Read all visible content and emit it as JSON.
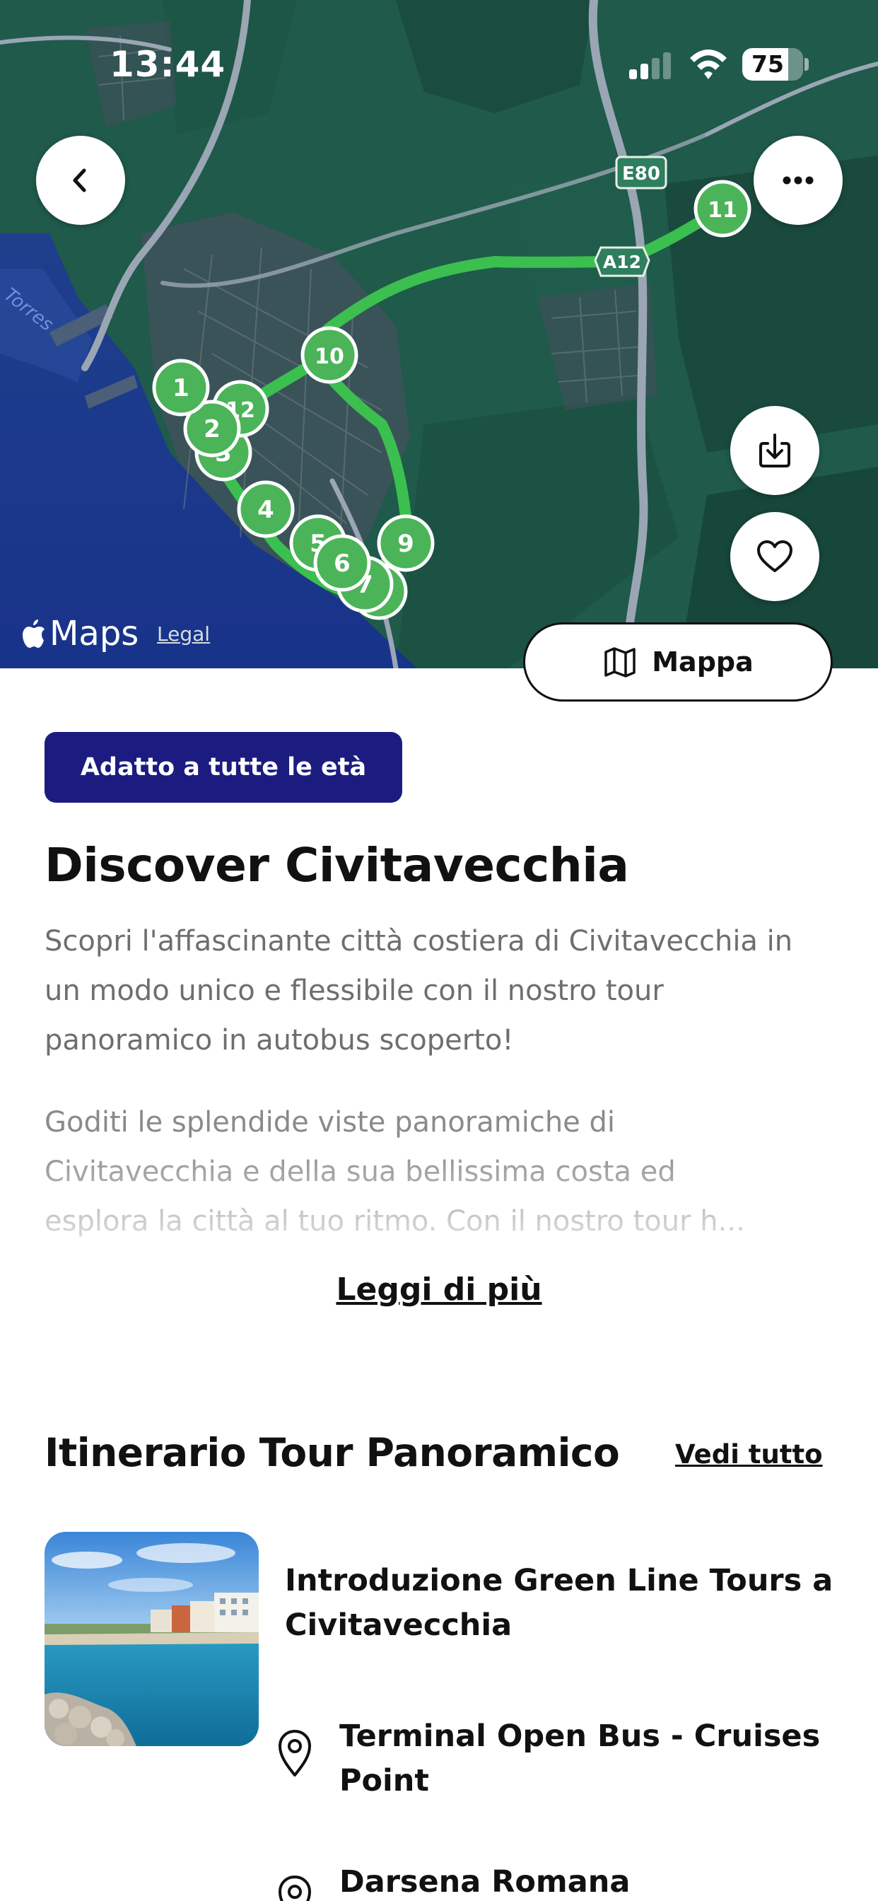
{
  "status_bar": {
    "time": "13:44",
    "battery_percent": 75
  },
  "map": {
    "attribution": "Maps",
    "legal": "Legal",
    "road_labels": [
      "E80",
      "A12",
      "Torres"
    ],
    "route_color": "#3bbf4f",
    "markers": [
      "1",
      "2",
      "12",
      "3",
      "4",
      "5",
      "6",
      "7",
      "8",
      "9",
      "10",
      "11"
    ],
    "toggle_label": "Mappa"
  },
  "badge": {
    "label": "Adatto a tutte le età",
    "color": "#1b1b80"
  },
  "tour": {
    "title": "Discover Civitavecchia",
    "description_1": "Scopri l'affascinante città costiera di Civitavecchia in un modo unico e flessibile con il nostro tour panoramico in autobus scoperto!",
    "description_2_lines": [
      "Goditi le splendide viste panoramiche di",
      "Civitavecchia e della sua bellissima costa ed",
      "esplora la città al tuo ritmo. Con il nostro tour h..."
    ],
    "read_more": "Leggi di più"
  },
  "itinerary": {
    "title": "Itinerario Tour Panoramico",
    "see_all": "Vedi tutto",
    "first_stop": {
      "title": "Introduzione Green Line Tours a Civitavecchia",
      "locations": [
        "Terminal Open Bus - Cruises Point",
        "Darsena Romana"
      ]
    }
  }
}
